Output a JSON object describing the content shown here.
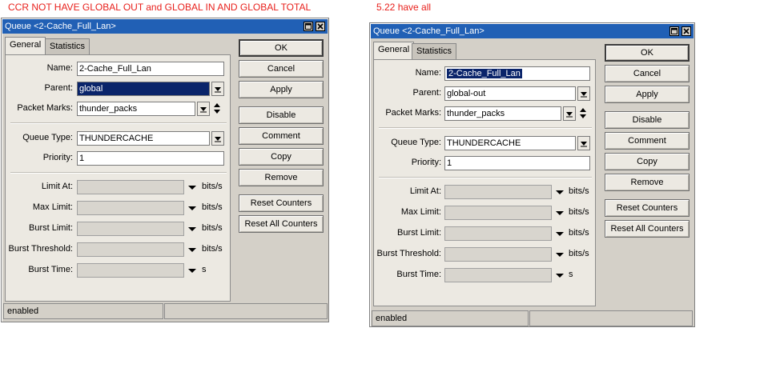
{
  "captions": {
    "left": "CCR NOT HAVE GLOBAL OUT and GLOBAL IN AND GLOBAL TOTAL",
    "right": "5.22 have all"
  },
  "colors": {
    "caption": "#e8201c",
    "titlebar": "#2160b5",
    "selection": "#0a246a"
  },
  "left_window": {
    "title": "Queue <2-Cache_Full_Lan>",
    "tabs": [
      "General",
      "Statistics"
    ],
    "fields": {
      "name": {
        "label": "Name:",
        "value": "2-Cache_Full_Lan"
      },
      "parent": {
        "label": "Parent:",
        "value": "global"
      },
      "packet_marks": {
        "label": "Packet Marks:",
        "value": "thunder_packs"
      },
      "queue_type": {
        "label": "Queue Type:",
        "value": "THUNDERCACHE"
      },
      "priority": {
        "label": "Priority:",
        "value": "1"
      },
      "limit_at": {
        "label": "Limit At:",
        "value": "",
        "unit": "bits/s"
      },
      "max_limit": {
        "label": "Max Limit:",
        "value": "",
        "unit": "bits/s"
      },
      "burst_limit": {
        "label": "Burst Limit:",
        "value": "",
        "unit": "bits/s"
      },
      "burst_threshold": {
        "label": "Burst Threshold:",
        "value": "",
        "unit": "bits/s"
      },
      "burst_time": {
        "label": "Burst Time:",
        "value": "",
        "unit": "s"
      }
    },
    "buttons": {
      "ok": "OK",
      "cancel": "Cancel",
      "apply": "Apply",
      "disable": "Disable",
      "comment": "Comment",
      "copy": "Copy",
      "remove": "Remove",
      "reset_counters": "Reset Counters",
      "reset_all_counters": "Reset All Counters"
    },
    "status": "enabled"
  },
  "right_window": {
    "title": "Queue <2-Cache_Full_Lan>",
    "tabs": [
      "General",
      "Statistics"
    ],
    "fields": {
      "name": {
        "label": "Name:",
        "value": "2-Cache_Full_Lan"
      },
      "parent": {
        "label": "Parent:",
        "value": "global-out"
      },
      "packet_marks": {
        "label": "Packet Marks:",
        "value": "thunder_packs"
      },
      "queue_type": {
        "label": "Queue Type:",
        "value": "THUNDERCACHE"
      },
      "priority": {
        "label": "Priority:",
        "value": "1"
      },
      "limit_at": {
        "label": "Limit At:",
        "value": "",
        "unit": "bits/s"
      },
      "max_limit": {
        "label": "Max Limit:",
        "value": "",
        "unit": "bits/s"
      },
      "burst_limit": {
        "label": "Burst Limit:",
        "value": "",
        "unit": "bits/s"
      },
      "burst_threshold": {
        "label": "Burst Threshold:",
        "value": "",
        "unit": "bits/s"
      },
      "burst_time": {
        "label": "Burst Time:",
        "value": "",
        "unit": "s"
      }
    },
    "buttons": {
      "ok": "OK",
      "cancel": "Cancel",
      "apply": "Apply",
      "disable": "Disable",
      "comment": "Comment",
      "copy": "Copy",
      "remove": "Remove",
      "reset_counters": "Reset Counters",
      "reset_all_counters": "Reset All Counters"
    },
    "status": "enabled"
  }
}
